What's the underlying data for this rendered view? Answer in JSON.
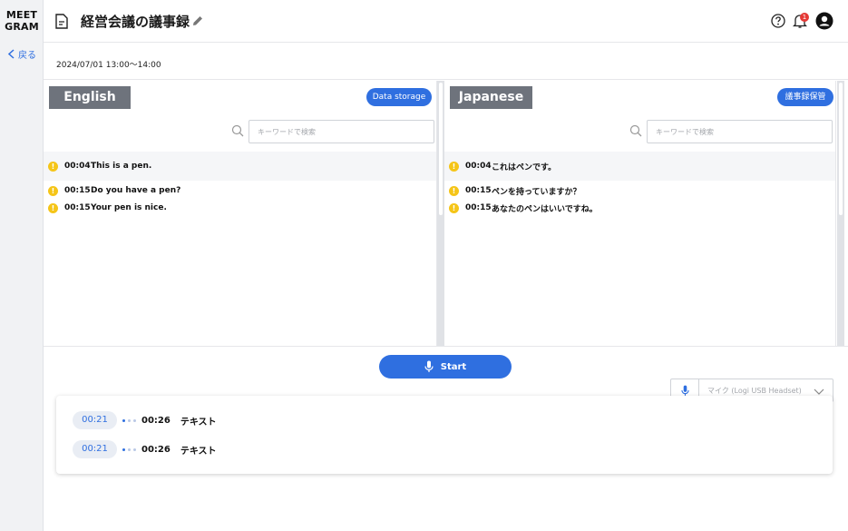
{
  "app": {
    "logo": "MEET\nGRAM",
    "logo_line1": "MEET",
    "logo_line2": "GRAM",
    "back_label": "戻る"
  },
  "header": {
    "title": "経営会議の議事録",
    "notification_count": "1",
    "icons": [
      "document-icon",
      "pencil-icon",
      "help-icon",
      "bell-icon",
      "user-icon"
    ]
  },
  "meeting": {
    "datetime": "2024/07/01 13:00〜14:00"
  },
  "panels": {
    "english": {
      "language": "English",
      "store_button": "Data storage",
      "search_placeholder": "キーワードで検索",
      "rows": [
        {
          "time": "00:04",
          "text": "This is a pen."
        },
        {
          "time": "00:15",
          "text": "Do you have a pen?"
        },
        {
          "time": "00:15",
          "text": "Your pen is nice."
        }
      ]
    },
    "japanese": {
      "language": "Japanese",
      "store_button": "議事録保管",
      "search_placeholder": "キーワードで検索",
      "rows": [
        {
          "time": "00:04",
          "text": "これはペンです。"
        },
        {
          "time": "00:15",
          "text": "ペンを持っていますか？"
        },
        {
          "time": "00:15",
          "text": "あなたのペンはいいですね。"
        }
      ]
    }
  },
  "controls": {
    "start_label": "Start",
    "mic_label": "マイク (Logi USB Headset)"
  },
  "transcript": [
    {
      "start": "00:21",
      "end": "00:26",
      "text": "テキスト"
    },
    {
      "start": "00:21",
      "end": "00:26",
      "text": "テキスト"
    }
  ],
  "colors": {
    "accent": "#2f6fe0",
    "tag_bg": "#6e737c",
    "warn": "#f5c518",
    "badge": "#e53935"
  }
}
